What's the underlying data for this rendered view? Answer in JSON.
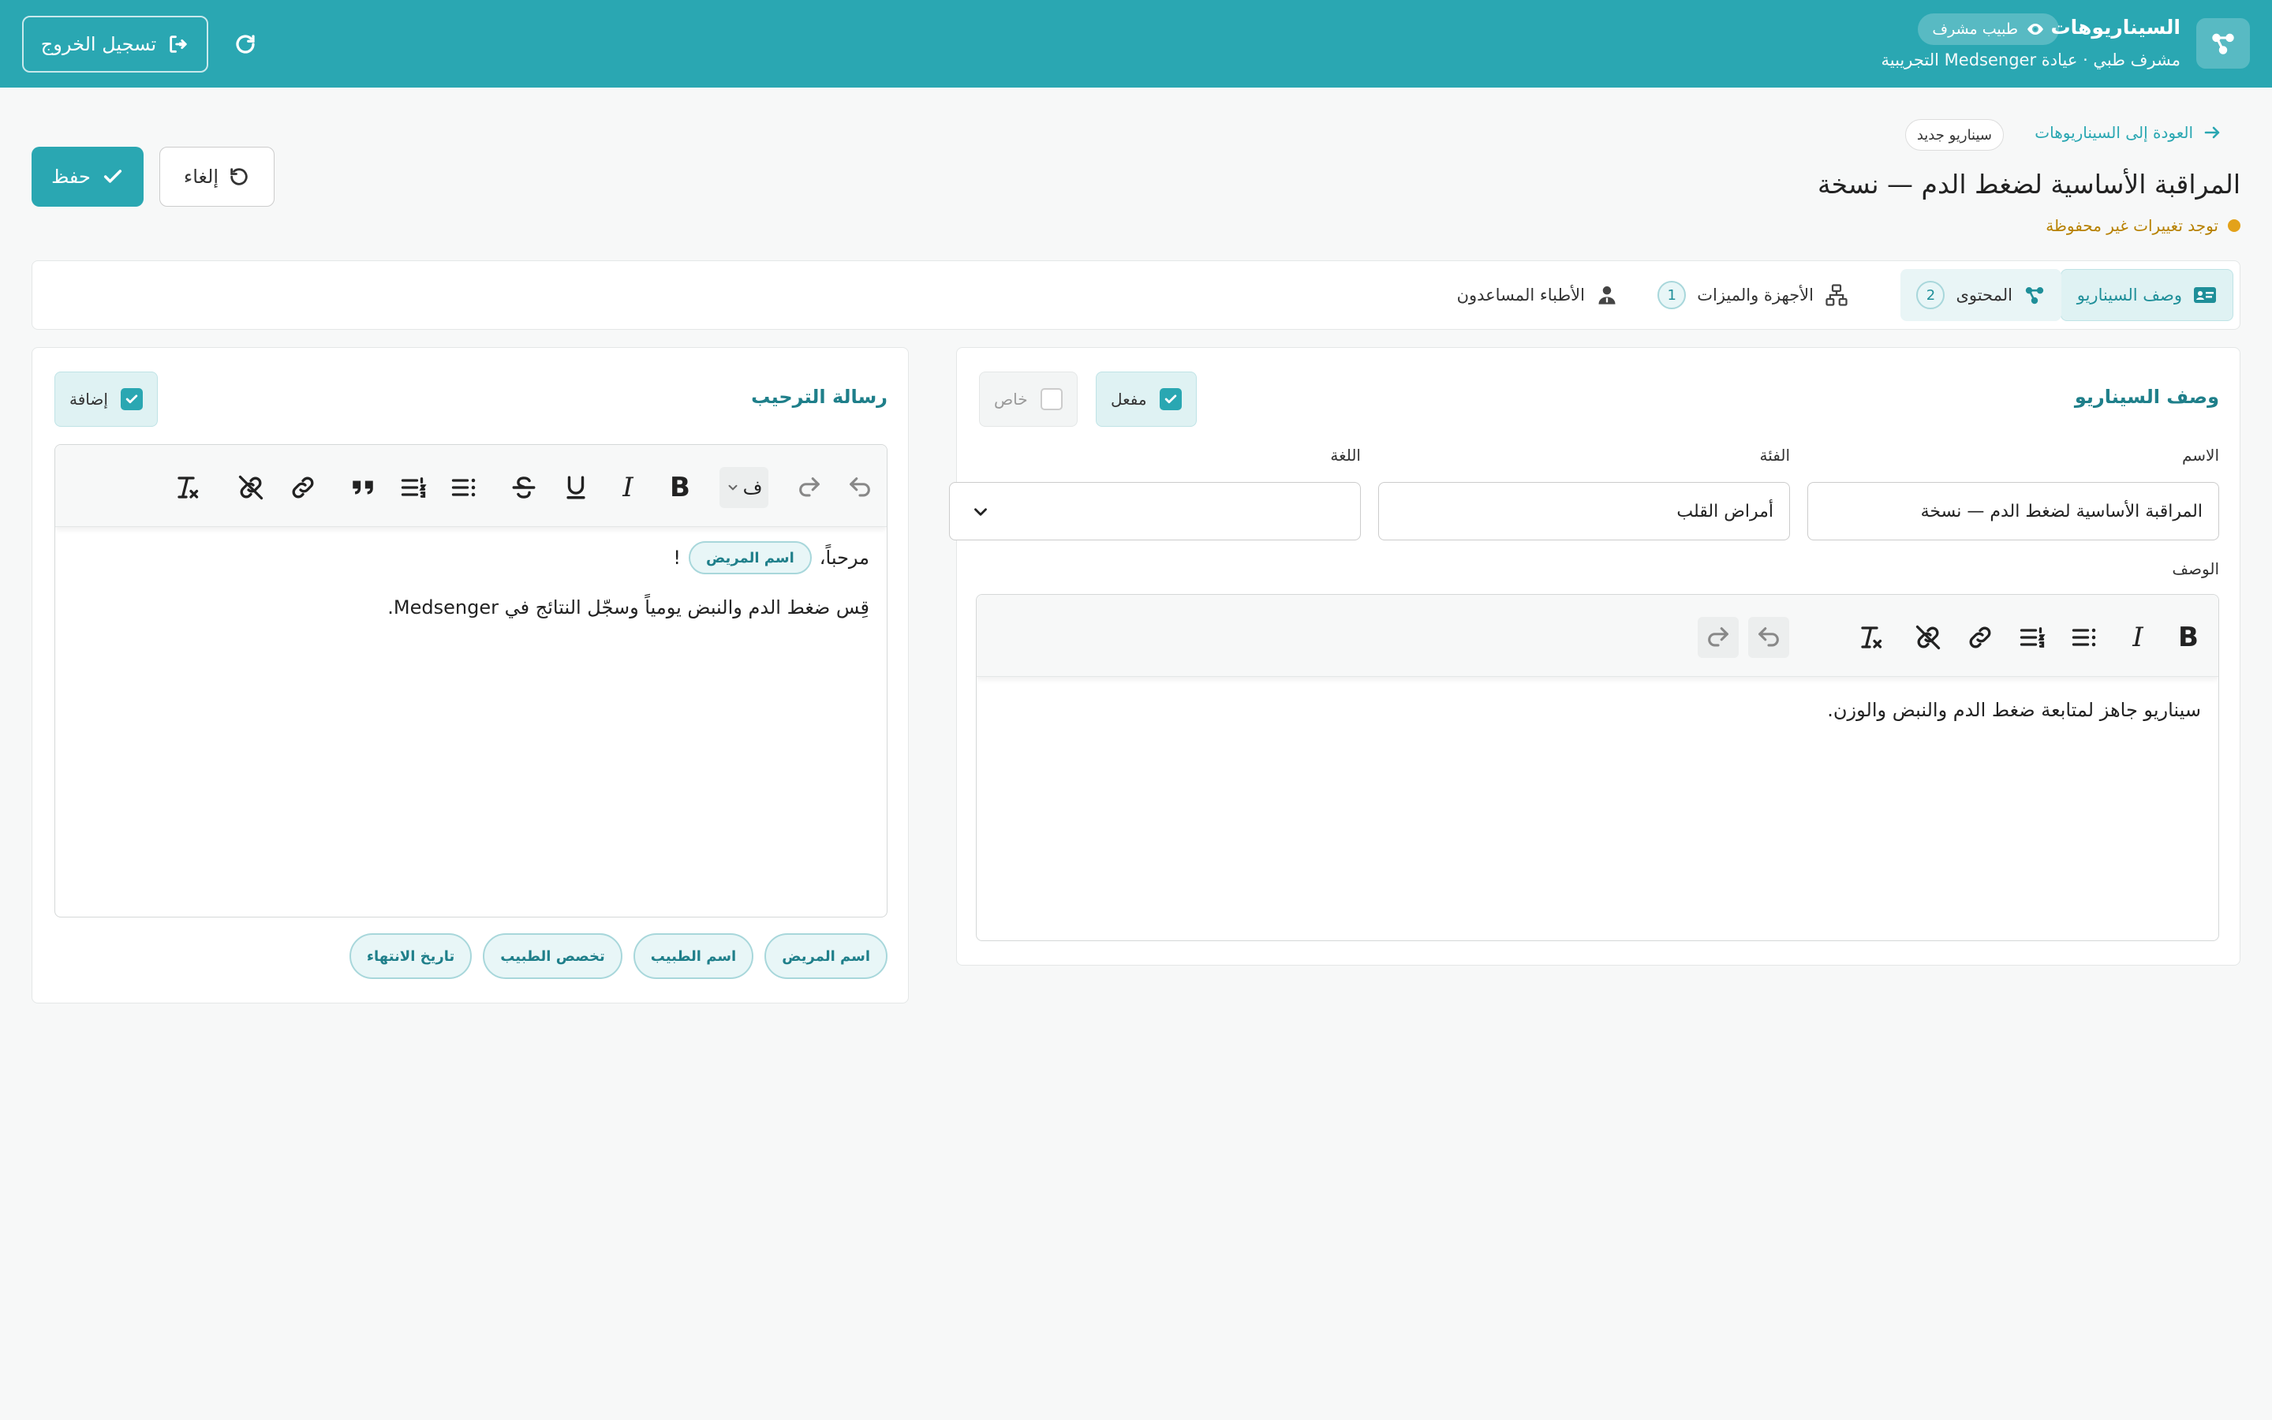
{
  "header": {
    "title": "السيناريوهات",
    "role_badge": "طبيب مشرف",
    "subtitle": "مشرف طبي · عيادة Medsenger التجريبية",
    "logout_label": "تسجيل الخروج",
    "bg_color": "#2aa7b2"
  },
  "page": {
    "back_link": "العودة إلى السيناريوهات",
    "new_badge": "سيناريو جديد",
    "title": "المراقبة الأساسية لضغط الدم — نسخة",
    "unsaved_notice": "توجد تغييرات غير محفوظة",
    "save_label": "حفظ",
    "cancel_label": "إلغاء"
  },
  "tabs": [
    {
      "label": "وصف السيناريو",
      "active": true
    },
    {
      "label": "المحتوى",
      "count": "2"
    },
    {
      "label": "الأجهزة والميزات",
      "count": "1"
    },
    {
      "label": "الأطباء المساعدون"
    }
  ],
  "description_panel": {
    "title": "وصف السيناريو",
    "enabled_label": "مفعل",
    "private_label": "خاص",
    "name_label": "الاسم",
    "name_value": "المراقبة الأساسية لضغط الدم — نسخة",
    "category_label": "الفئة",
    "category_value": "أمراض القلب",
    "language_label": "اللغة",
    "language_value": "",
    "description_label": "الوصف",
    "description_text": "سيناريو جاهز لمتابعة ضغط الدم والنبض والوزن."
  },
  "welcome_panel": {
    "title": "رسالة الترحيب",
    "add_label": "إضافة",
    "heading_select": "ف",
    "greeting_prefix": "مرحباً،",
    "greeting_chip": "اسم المريض",
    "greeting_suffix": "!",
    "body_text": "قِس ضغط الدم والنبض يومياً وسجّل النتائج في Medsenger.",
    "variables": [
      "اسم المريض",
      "اسم الطبيب",
      "تخصص الطبيب",
      "تاريخ الانتهاء"
    ]
  }
}
